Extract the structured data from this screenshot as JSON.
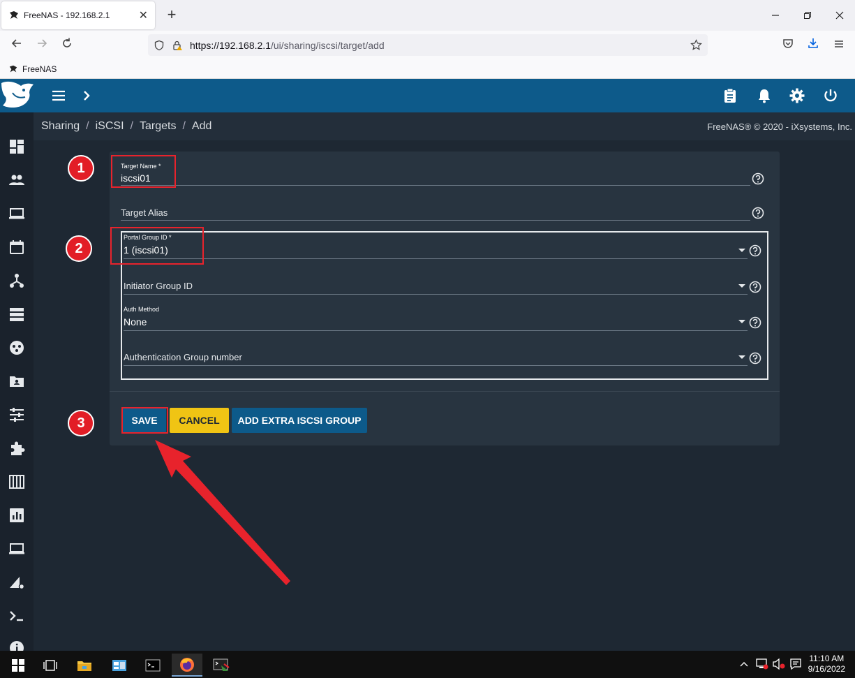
{
  "browser": {
    "tab_title": "FreeNAS - 192.168.2.1",
    "tab_close": "✕",
    "new_tab": "+",
    "url_host": "https://192.168.2.1",
    "url_path": "/ui/sharing/iscsi/target/add",
    "bookmark": "FreeNAS"
  },
  "breadcrumb": {
    "items": [
      "Sharing",
      "iSCSI",
      "Targets",
      "Add"
    ],
    "separator": "/"
  },
  "copyright": "FreeNAS® © 2020 - iXsystems, Inc.",
  "form": {
    "target_name_label": "Target Name *",
    "target_name_value": "iscsi01",
    "target_alias_label": "Target Alias",
    "portal_group_label": "Portal Group ID *",
    "portal_group_value": "1 (iscsi01)",
    "initiator_group_label": "Initiator Group ID",
    "auth_method_label": "Auth Method",
    "auth_method_value": "None",
    "auth_group_label": "Authentication Group number"
  },
  "buttons": {
    "save": "SAVE",
    "cancel": "CANCEL",
    "extra": "ADD EXTRA ISCSI GROUP"
  },
  "annotations": [
    "1",
    "2",
    "3"
  ],
  "taskbar": {
    "time": "11:10 AM",
    "date": "9/16/2022"
  },
  "colors": {
    "header": "#0d5a8a",
    "accent_yellow": "#f0c414",
    "annotation_red": "#e21d26"
  }
}
